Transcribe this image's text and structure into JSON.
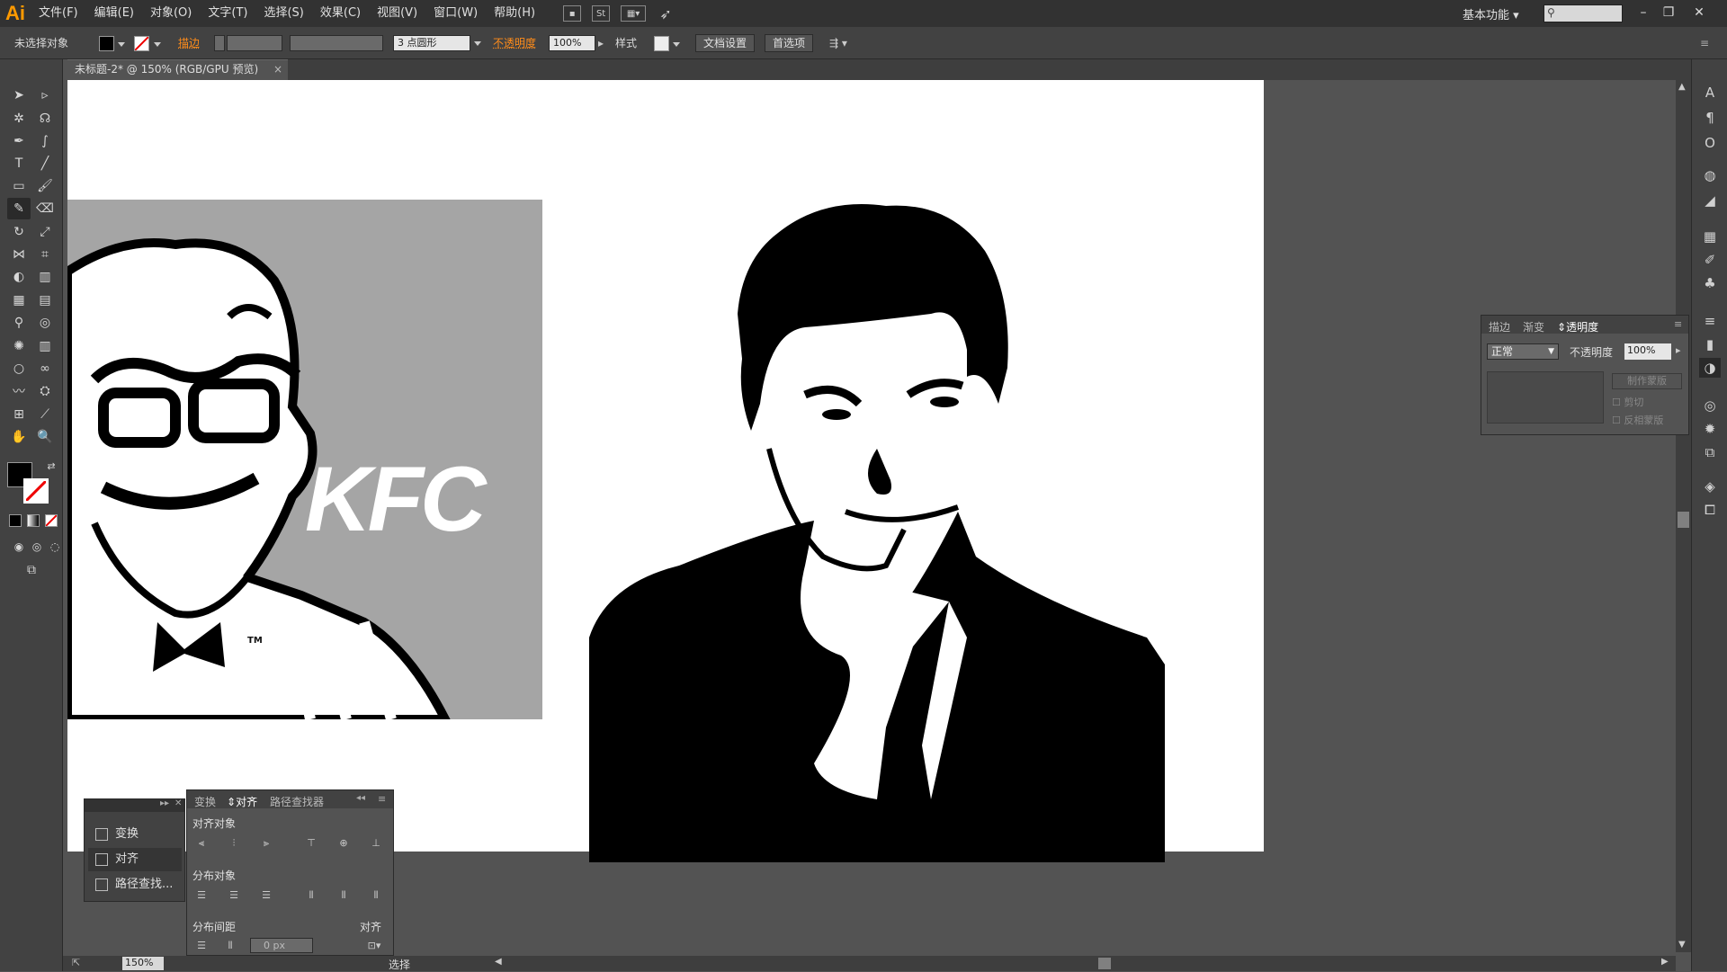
{
  "app": {
    "logo": "Ai"
  },
  "menu": [
    "文件(F)",
    "编辑(E)",
    "对象(O)",
    "文字(T)",
    "选择(S)",
    "效果(C)",
    "视图(V)",
    "窗口(W)",
    "帮助(H)"
  ],
  "menubar": {
    "workspace": "基本功能",
    "bridge_icon": "St"
  },
  "control": {
    "selection_status": "未选择对象",
    "stroke_label": "描边",
    "brush_label": "3 点圆形",
    "opacity_label": "不透明度",
    "opacity_value": "100%",
    "style_label": "样式",
    "doc_setup_button": "文档设置",
    "prefs_button": "首选项"
  },
  "document": {
    "tab_title": "未标题-2* @ 150% (RGB/GPU 预览)"
  },
  "artwork": {
    "logo_text": "KFC",
    "trademark": "TM"
  },
  "transparency_panel": {
    "tabs": [
      "描边",
      "渐变",
      "透明度"
    ],
    "blend_mode": "正常",
    "opacity_label": "不透明度",
    "opacity_value": "100%",
    "make_mask_button": "制作蒙版",
    "clip_label": "剪切",
    "invert_mask_label": "反相蒙版"
  },
  "mini_panel": {
    "items": [
      "变换",
      "对齐",
      "路径查找..."
    ]
  },
  "align_panel": {
    "tabs": [
      "变换",
      "对齐",
      "路径查找器"
    ],
    "align_objects_label": "对齐对象",
    "distribute_objects_label": "分布对象",
    "distribute_spacing_label": "分布间距",
    "align_to_label": "对齐",
    "spacing_value": "0 px"
  },
  "status": {
    "zoom": "150%",
    "status_text": "选择"
  },
  "colors": {
    "accent_orange": "#ff8c1a",
    "ui_dark": "#424242",
    "canvas_bg": "#535353"
  }
}
